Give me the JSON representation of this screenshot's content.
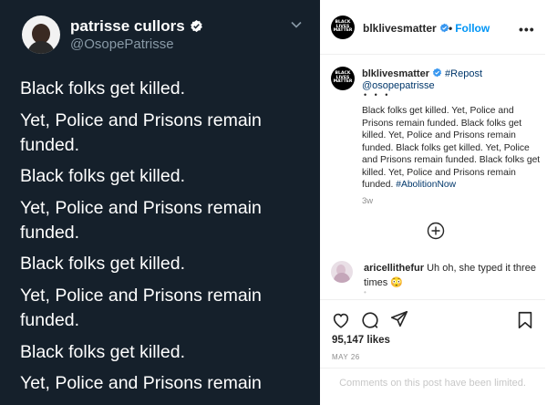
{
  "tweet": {
    "name": "patrisse cullors",
    "handle": "@OsopePatrisse",
    "lines": [
      "Black folks get killed.",
      "Yet, Police and Prisons remain\nfunded.",
      "Black folks get killed.",
      "Yet, Police and Prisons remain\nfunded.",
      "Black folks get killed.",
      "Yet, Police and Prisons remain\nfunded.",
      "Black folks get killed.",
      "Yet, Police and Prisons remain"
    ]
  },
  "instagram": {
    "header": {
      "logo_text": "BLACK LIVES MATTER",
      "username": "blklivesmatter",
      "separator": "•",
      "follow_label": "Follow",
      "more_label": "•••"
    },
    "post": {
      "username": "blklivesmatter",
      "repost_tag": "#Repost",
      "repost_handle": "@osopepatrisse",
      "dots": "• • •",
      "caption_text": "Black folks get killed.  Yet, Police and Prisons remain funded. Black folks get killed.  Yet, Police and Prisons remain funded. Black folks get killed.  Yet, Police and Prisons remain funded. Black folks get killed.  Yet, Police and Prisons remain funded.",
      "hashtag": "#AbolitionNow",
      "time": "3w"
    },
    "comment": {
      "username": "aricellithefur",
      "text": "Uh oh, she typed it three times 😳",
      "more": "•"
    },
    "likes": "95,147 likes",
    "date": "MAY 26",
    "limited_notice": "Comments on this post have been limited."
  },
  "colors": {
    "tweet_bg": "#15202b",
    "twitter_verified": "#1da1f2",
    "instagram_verified": "#3897f0",
    "follow_blue": "#0095f6",
    "link_blue": "#00376b"
  }
}
